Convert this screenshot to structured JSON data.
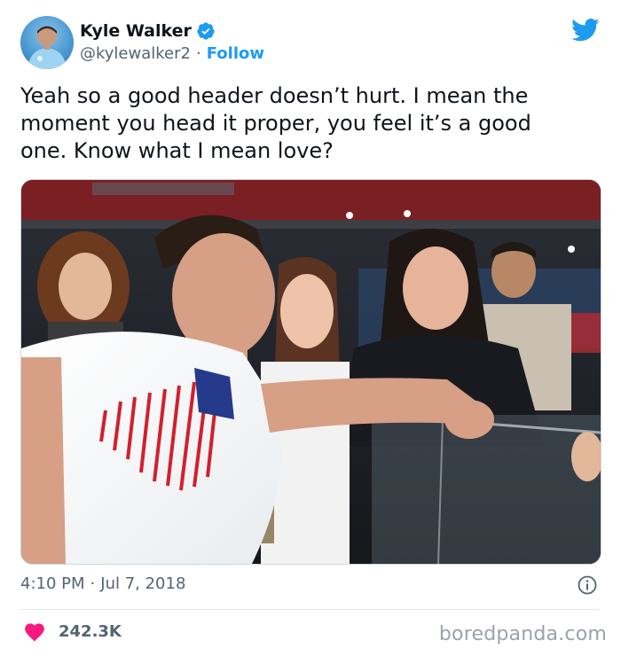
{
  "author": {
    "display_name": "Kyle Walker",
    "handle": "@kylewalker2",
    "separator": "·",
    "follow_label": "Follow",
    "verified_icon": "verified-badge-icon",
    "brand_icon": "twitter-bird-icon"
  },
  "tweet": {
    "text": "Yeah so a good header doesn’t hurt. I mean the\nmoment you head it proper, you feel it’s a good\none. Know what I mean love?"
  },
  "meta": {
    "time": "4:10 PM",
    "separator": "·",
    "date": "Jul 7, 2018",
    "info_icon": "info-icon"
  },
  "engagement": {
    "like_icon": "heart-icon",
    "like_count": "242.3K"
  },
  "watermark": "boredpanda.com",
  "colors": {
    "accent": "#1d9bf0",
    "heart": "#f91880",
    "text": "#0f1419",
    "muted": "#536471"
  }
}
